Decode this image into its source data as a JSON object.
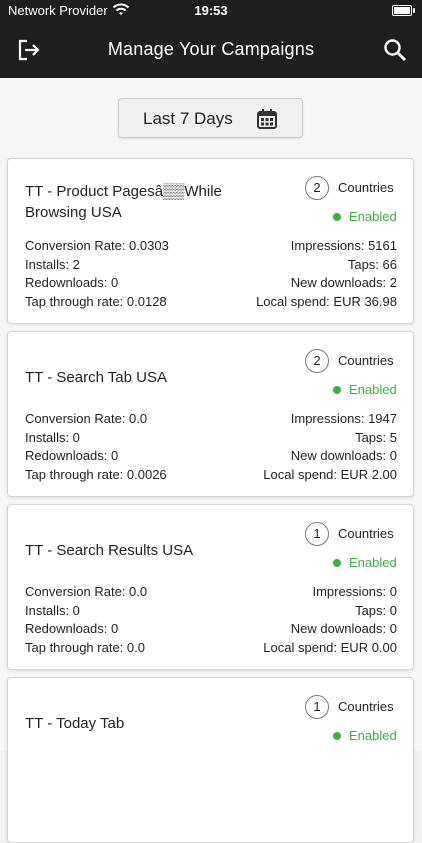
{
  "status_bar": {
    "carrier": "Network Provider",
    "time": "19:53"
  },
  "app_bar": {
    "title": "Manage Your Campaigns",
    "logout_icon": "logout-icon",
    "search_icon": "search-icon"
  },
  "date_range": {
    "label": "Last 7 Days",
    "icon": "calendar-icon"
  },
  "colors": {
    "app_bar_bg": "#1f1f1f",
    "enabled_green": "#3cb043"
  },
  "campaigns": [
    {
      "name": "TT - Product Pagesâ▒▒While Browsing USA",
      "country_count": "2",
      "countries_label": "Countries",
      "status": "Enabled",
      "left": [
        "Conversion Rate: 0.0303",
        "Installs: 2",
        "Redownloads: 0",
        "Tap through rate: 0.0128"
      ],
      "right": [
        "Impressions: 5161",
        "Taps: 66",
        "New downloads: 2",
        "Local spend: EUR 36.98"
      ]
    },
    {
      "name": "TT - Search Tab USA",
      "country_count": "2",
      "countries_label": "Countries",
      "status": "Enabled",
      "left": [
        "Conversion Rate: 0.0",
        "Installs: 0",
        "Redownloads: 0",
        "Tap through rate: 0.0026"
      ],
      "right": [
        "Impressions: 1947",
        "Taps: 5",
        "New downloads: 0",
        "Local spend: EUR 2.00"
      ]
    },
    {
      "name": "TT - Search Results USA",
      "country_count": "1",
      "countries_label": "Countries",
      "status": "Enabled",
      "left": [
        "Conversion Rate: 0.0",
        "Installs: 0",
        "Redownloads: 0",
        "Tap through rate: 0.0"
      ],
      "right": [
        "Impressions: 0",
        "Taps: 0",
        "New downloads: 0",
        "Local spend: EUR 0.00"
      ]
    },
    {
      "name": "TT - Today Tab",
      "country_count": "1",
      "countries_label": "Countries",
      "status": "Enabled",
      "left": [],
      "right": []
    }
  ]
}
